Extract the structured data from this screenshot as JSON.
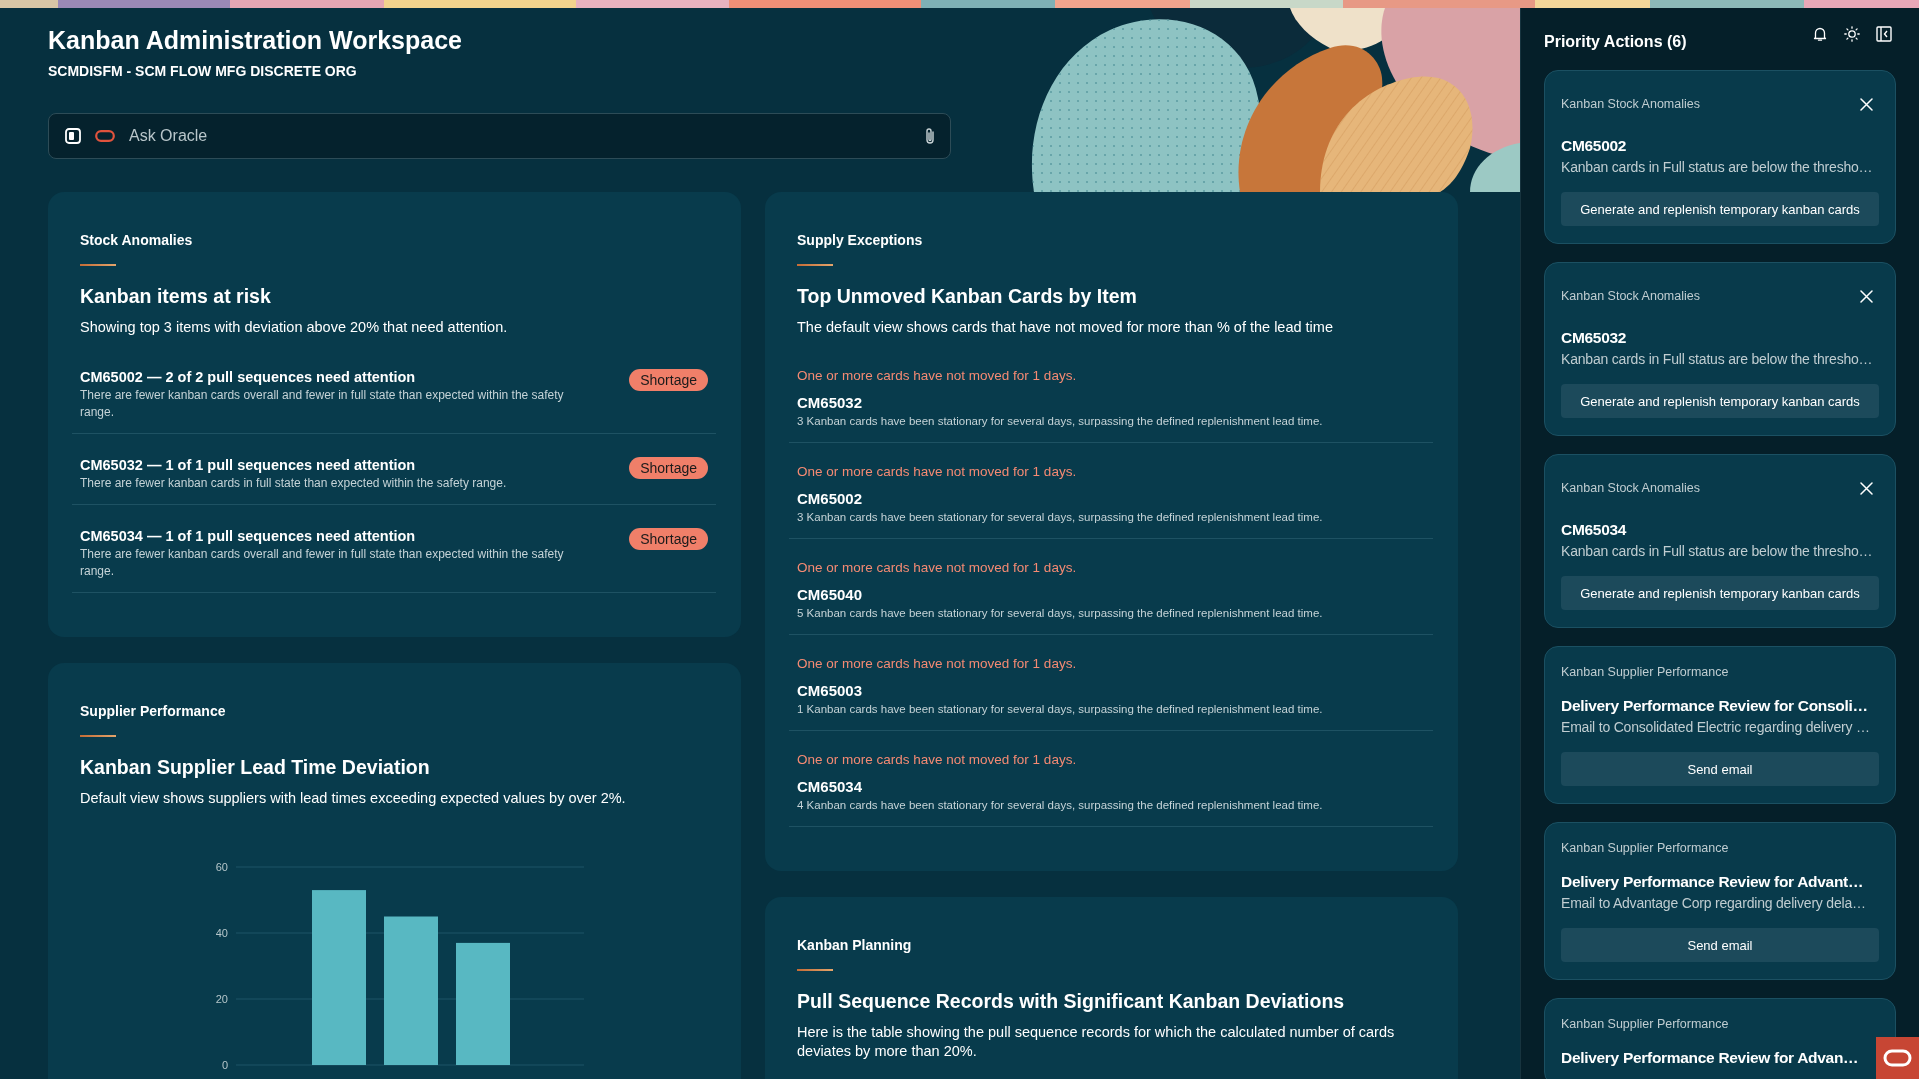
{
  "header": {
    "title": "Kanban Administration Workspace",
    "subtitle": "SCMDISFM - SCM FLOW MFG DISCRETE ORG"
  },
  "ask_bar": {
    "placeholder": "Ask Oracle"
  },
  "stock_anomalies": {
    "section": "Stock Anomalies",
    "heading": "Kanban items at risk",
    "description": "Showing top 3 items with deviation above 20% that need attention.",
    "items": [
      {
        "title": "CM65002 — 2 of 2 pull sequences need attention",
        "description": "There are fewer kanban cards overall and fewer in full state than expected within the safety range.",
        "badge": "Shortage"
      },
      {
        "title": "CM65032 — 1 of 1 pull sequences need attention",
        "description": "There are fewer kanban cards in full state than expected within the safety range.",
        "badge": "Shortage"
      },
      {
        "title": "CM65034 — 1 of 1 pull sequences need attention",
        "description": "There are fewer kanban cards overall and fewer in full state than expected within the safety range.",
        "badge": "Shortage"
      }
    ]
  },
  "supply_exceptions": {
    "section": "Supply Exceptions",
    "heading": "Top Unmoved Kanban Cards by Item",
    "description": "The default view shows cards that have not moved for more than % of the lead time",
    "items": [
      {
        "alert": "One or more cards have not moved for 1 days.",
        "item": "CM65032",
        "description": "3 Kanban cards have been stationary for several days, surpassing the defined replenishment lead time."
      },
      {
        "alert": "One or more cards have not moved for 1 days.",
        "item": "CM65002",
        "description": "3 Kanban cards have been stationary for several days, surpassing the defined replenishment lead time."
      },
      {
        "alert": "One or more cards have not moved for 1 days.",
        "item": "CM65040",
        "description": "5 Kanban cards have been stationary for several days, surpassing the defined replenishment lead time."
      },
      {
        "alert": "One or more cards have not moved for 1 days.",
        "item": "CM65003",
        "description": "1 Kanban cards have been stationary for several days, surpassing the defined replenishment lead time."
      },
      {
        "alert": "One or more cards have not moved for 1 days.",
        "item": "CM65034",
        "description": "4 Kanban cards have been stationary for several days, surpassing the defined replenishment lead time."
      }
    ]
  },
  "supplier_performance": {
    "section": "Supplier Performance",
    "heading": "Kanban Supplier Lead Time Deviation",
    "description": "Default view shows suppliers with lead times exceeding expected values by over 2%.",
    "chart_data": {
      "type": "bar",
      "values": [
        53,
        45,
        37
      ],
      "ylim": [
        0,
        60
      ],
      "yticks": [
        0,
        20,
        40,
        60
      ]
    }
  },
  "kanban_planning": {
    "section": "Kanban Planning",
    "heading": "Pull Sequence Records with Significant Kanban Deviations",
    "description": "Here is the table showing the pull sequence records for which the calculated number of cards deviates by more than 20%."
  },
  "priority_actions": {
    "title": "Priority Actions (6)",
    "cards": [
      {
        "category": "Kanban Stock Anomalies",
        "closable": true,
        "name": "CM65002",
        "description": "Kanban cards in Full status are below the thresho…",
        "action": "Generate and replenish temporary kanban cards"
      },
      {
        "category": "Kanban Stock Anomalies",
        "closable": true,
        "name": "CM65032",
        "description": "Kanban cards in Full status are below the thresho…",
        "action": "Generate and replenish temporary kanban cards"
      },
      {
        "category": "Kanban Stock Anomalies",
        "closable": true,
        "name": "CM65034",
        "description": "Kanban cards in Full status are below the thresho…",
        "action": "Generate and replenish temporary kanban cards"
      },
      {
        "category": "Kanban Supplier Performance",
        "closable": false,
        "name": "Delivery Performance Review for Consoli…",
        "description": "Email to Consolidated Electric regarding delivery …",
        "action": "Send email"
      },
      {
        "category": "Kanban Supplier Performance",
        "closable": false,
        "name": "Delivery Performance Review for Advant…",
        "description": "Email to Advantage Corp regarding delivery dela…",
        "action": "Send email"
      },
      {
        "category": "Kanban Supplier Performance",
        "closable": false,
        "name": "Delivery Performance Review for Advan…"
      }
    ]
  }
}
